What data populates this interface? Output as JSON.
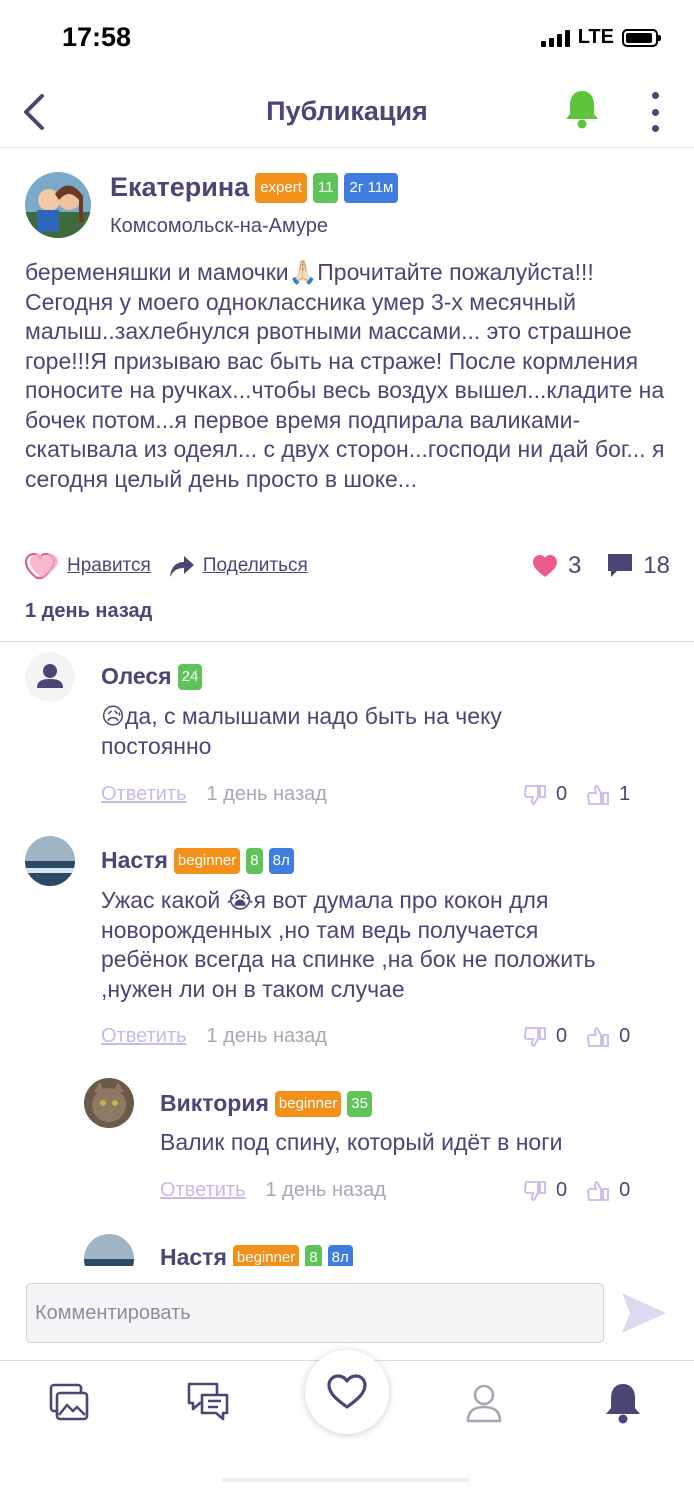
{
  "status": {
    "time": "17:58",
    "network": "LTE"
  },
  "header": {
    "title": "Публикация"
  },
  "post": {
    "author": "Екатерина",
    "badges": {
      "level": "expert",
      "count": "11",
      "age": "2г 11м"
    },
    "city": "Комсомольск-на-Амуре",
    "text": "беременяшки и мамочки🙏🏻Прочитайте пожалуйста!!! Сегодня у моего одноклассника умер 3-х месячный малыш..захлебнулся рвотными массами... это страшное горе!!!Я призываю вас быть на страже! После кормления поносите на ручках...чтобы весь воздух вышел...кладите на бочек потом...я первое время подпирала валиками-скатывала из одеял... с двух сторон...господи ни дай бог... я сегодня целый день просто в шоке...",
    "like_label": "Нравится",
    "share_label": "Поделиться",
    "likes": "3",
    "comments": "18",
    "time": "1 день назад"
  },
  "comments": [
    {
      "author": "Олеся",
      "badge_count": "24",
      "text": "😥да, с малышами надо быть на чеку постоянно",
      "reply": "Ответить",
      "time": "1 день назад",
      "dislikes": "0",
      "likes": "1"
    },
    {
      "author": "Настя",
      "badge_level": "beginner",
      "badge_count": "8",
      "badge_age": "8л",
      "text": "Ужас какой 😭я вот думала про кокон для новорожденных ,но там ведь получается ребёнок всегда на спинке ,на бок не положить ,нужен ли он в таком случае",
      "reply": "Ответить",
      "time": "1 день назад",
      "dislikes": "0",
      "likes": "0"
    },
    {
      "author": "Виктория",
      "badge_level": "beginner",
      "badge_count": "35",
      "text": "Валик под спину, который идёт в ноги",
      "reply": "Ответить",
      "time": "1 день назад",
      "dislikes": "0",
      "likes": "0"
    },
    {
      "author": "Настя",
      "badge_level": "beginner",
      "badge_count": "8",
      "badge_age": "8л"
    }
  ],
  "input": {
    "placeholder": "Комментировать"
  },
  "colors": {
    "primary": "#4a4676",
    "bell_green": "#5ec43a",
    "like_pink": "#ec5b8d",
    "expert": "#f39019",
    "count": "#5ec45a",
    "age": "#3f7de0"
  }
}
